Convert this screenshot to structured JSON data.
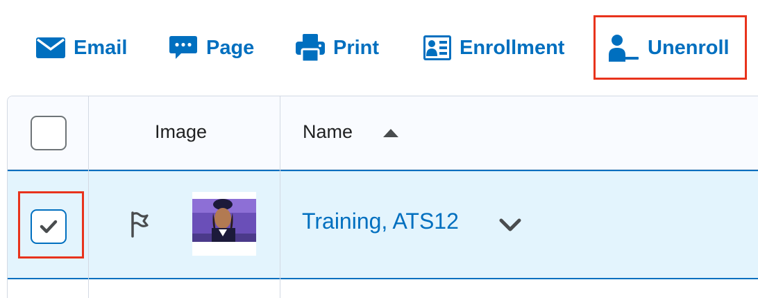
{
  "toolbar": {
    "email_label": "Email",
    "page_label": "Page",
    "print_label": "Print",
    "enrollment_label": "Enrollment",
    "unenroll_label": "Unenroll"
  },
  "table": {
    "columns": {
      "image": "Image",
      "name": "Name"
    },
    "rows": [
      {
        "name": "Training, ATS12",
        "selected": true
      }
    ]
  },
  "colors": {
    "link_blue": "#006fbf",
    "highlight_red": "#e8331c",
    "selected_row_bg": "#e3f4fd",
    "header_bg": "#f9fbff"
  },
  "icons": {
    "email": "envelope-icon",
    "page": "chat-bubble-icon",
    "print": "printer-icon",
    "enrollment": "id-card-icon",
    "unenroll": "user-minus-icon",
    "sort": "sort-ascending-icon",
    "flag": "flag-icon",
    "row_menu": "chevron-down-icon"
  }
}
